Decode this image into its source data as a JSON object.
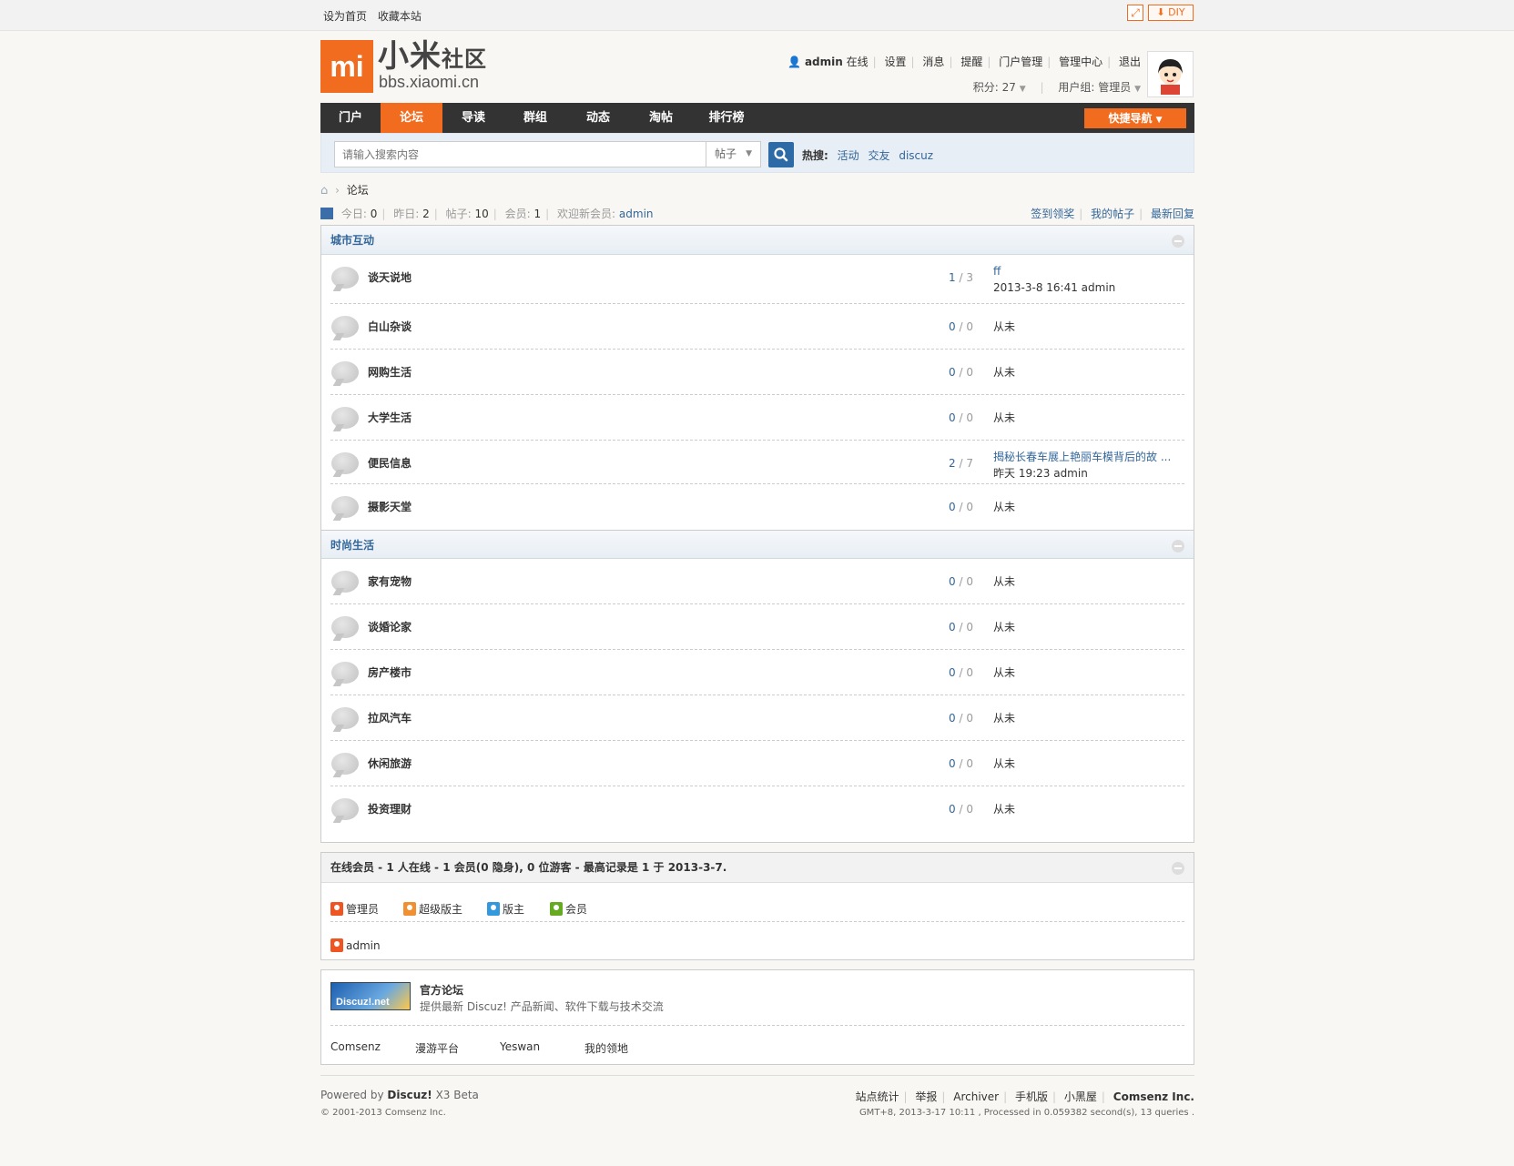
{
  "topbar": {
    "set_home": "设为首页",
    "bookmark": "收藏本站",
    "diy": "DIY",
    "expand_icon": "expand-icon"
  },
  "logo": {
    "mark": "mi",
    "name": "小米",
    "name_small": "社区",
    "url": "bbs.xiaomi.cn"
  },
  "user": {
    "name": "admin",
    "status": "在线",
    "links": [
      "设置",
      "消息",
      "提醒",
      "门户管理",
      "管理中心",
      "退出"
    ],
    "points_label": "积分: 27",
    "group_label": "用户组: 管理员"
  },
  "nav": {
    "items": [
      "门户",
      "论坛",
      "导读",
      "群组",
      "动态",
      "淘帖",
      "排行榜"
    ],
    "active": "论坛",
    "quick": "快捷导航"
  },
  "search": {
    "placeholder": "请输入搜索内容",
    "type": "帖子",
    "hot_label": "热搜:",
    "hot": [
      "活动",
      "交友",
      "discuz"
    ]
  },
  "breadcrumb": {
    "current": "论坛"
  },
  "stats": {
    "today_label": "今日:",
    "today": "0",
    "yesterday_label": "昨日:",
    "yesterday": "2",
    "posts_label": "帖子:",
    "posts": "10",
    "members_label": "会员:",
    "members": "1",
    "welcome_label": "欢迎新会员:",
    "newest": "admin",
    "links": [
      "签到领奖",
      "我的帖子",
      "最新回复"
    ]
  },
  "categories": [
    {
      "title": "城市互动",
      "forums": [
        {
          "name": "谈天说地",
          "threads": "1",
          "posts": "3",
          "last_title": "ff",
          "last_info": "2013-3-8 16:41 admin"
        },
        {
          "name": "白山杂谈",
          "threads": "0",
          "posts": "0",
          "last": "从未"
        },
        {
          "name": "网购生活",
          "threads": "0",
          "posts": "0",
          "last": "从未"
        },
        {
          "name": "大学生活",
          "threads": "0",
          "posts": "0",
          "last": "从未"
        },
        {
          "name": "便民信息",
          "threads": "2",
          "posts": "7",
          "last_title": "揭秘长春车展上艳丽车模背后的故 ...",
          "last_info": "昨天 19:23 admin"
        },
        {
          "name": "摄影天堂",
          "threads": "0",
          "posts": "0",
          "last": "从未"
        }
      ]
    },
    {
      "title": "时尚生活",
      "forums": [
        {
          "name": "家有宠物",
          "threads": "0",
          "posts": "0",
          "last": "从未"
        },
        {
          "name": "谈婚论家",
          "threads": "0",
          "posts": "0",
          "last": "从未"
        },
        {
          "name": "房产楼市",
          "threads": "0",
          "posts": "0",
          "last": "从未"
        },
        {
          "name": "拉风汽车",
          "threads": "0",
          "posts": "0",
          "last": "从未"
        },
        {
          "name": "休闲旅游",
          "threads": "0",
          "posts": "0",
          "last": "从未"
        },
        {
          "name": "投资理财",
          "threads": "0",
          "posts": "0",
          "last": "从未"
        }
      ]
    }
  ],
  "online": {
    "header": "在线会员 - 1 人在线 - 1 会员(0 隐身), 0 位游客 - 最高记录是 1 于 2013-3-7.",
    "legend": [
      {
        "label": "管理员",
        "color": "#ee5522"
      },
      {
        "label": "超级版主",
        "color": "#f09030"
      },
      {
        "label": "版主",
        "color": "#3399dd"
      },
      {
        "label": "会员",
        "color": "#66aa22"
      }
    ],
    "user": "admin"
  },
  "links": {
    "logo_text": "Discuz!.net",
    "official_title": "官方论坛",
    "official_desc": "提供最新 Discuz! 产品新闻、软件下载与技术交流",
    "friends": [
      "Comsenz",
      "漫游平台",
      "Yeswan",
      "我的领地"
    ]
  },
  "footer": {
    "powered_by": "Powered by",
    "product": "Discuz!",
    "version": "X3 Beta",
    "copyright": "© 2001-2013 Comsenz Inc.",
    "links": [
      "站点统计",
      "举报",
      "Archiver",
      "手机版",
      "小黑屋"
    ],
    "company": "Comsenz Inc.",
    "gmt": "GMT+8, 2013-3-17 10:11 , Processed in 0.059382 second(s), 13 queries ."
  },
  "colors": {
    "accent": "#f26c1f",
    "nav_bg": "#333333",
    "link": "#336699"
  }
}
